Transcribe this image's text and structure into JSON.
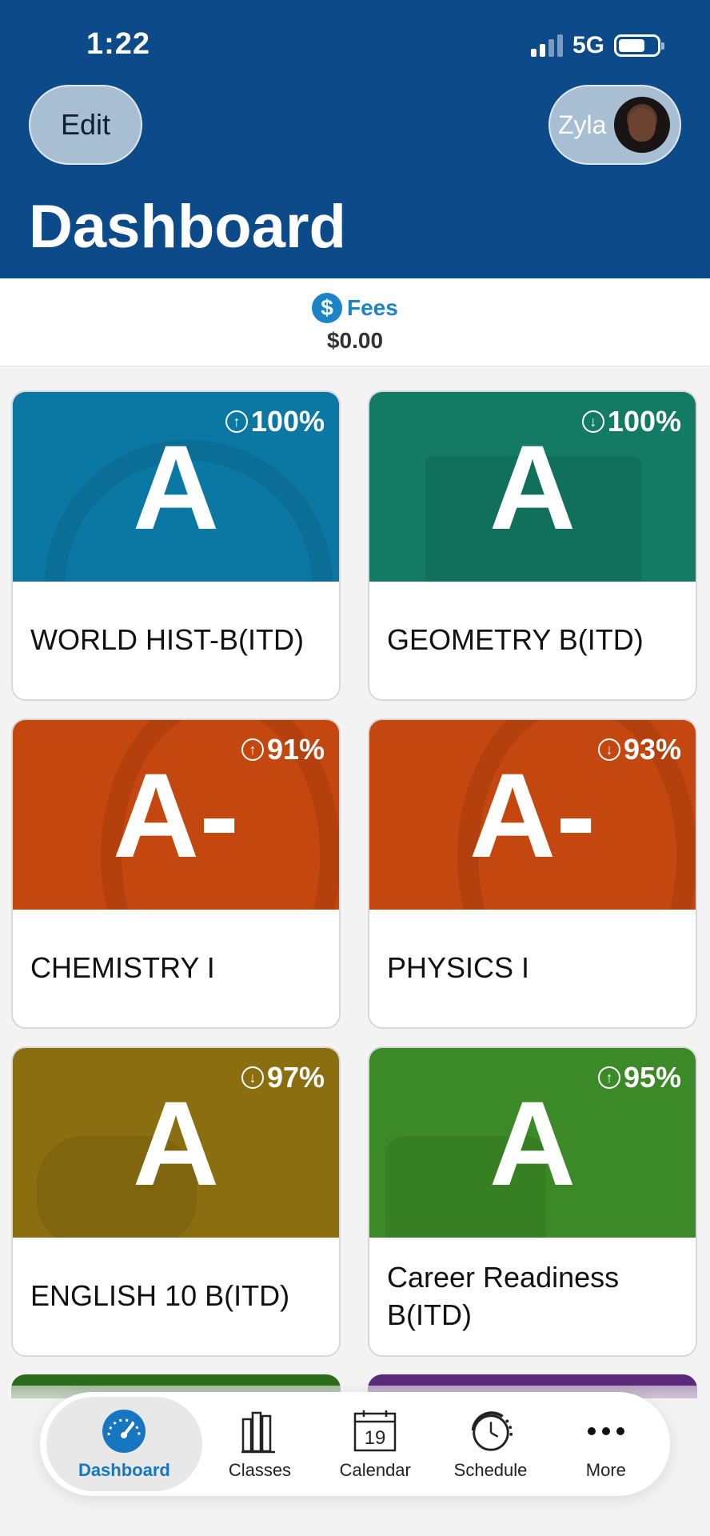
{
  "status": {
    "time": "1:22",
    "network": "5G"
  },
  "header": {
    "edit_label": "Edit",
    "user_name": "Zyla",
    "title": "Dashboard"
  },
  "fees": {
    "label": "Fees",
    "amount": "$0.00"
  },
  "courses": [
    {
      "grade": "A",
      "percent": "100%",
      "trend": "up",
      "name": "WORLD HIST-B(ITD)",
      "color": "#0b78a4"
    },
    {
      "grade": "A",
      "percent": "100%",
      "trend": "down",
      "name": "GEOMETRY B(ITD)",
      "color": "#137a64"
    },
    {
      "grade": "A-",
      "percent": "91%",
      "trend": "up",
      "name": "CHEMISTRY I",
      "color": "#c4470f"
    },
    {
      "grade": "A-",
      "percent": "93%",
      "trend": "down",
      "name": "PHYSICS I",
      "color": "#c4470f"
    },
    {
      "grade": "A",
      "percent": "97%",
      "trend": "down",
      "name": "ENGLISH 10 B(ITD)",
      "color": "#8a6e0f"
    },
    {
      "grade": "A",
      "percent": "95%",
      "trend": "up",
      "name": "Career Readiness B(ITD)",
      "color": "#3c8a27"
    }
  ],
  "tabs": [
    {
      "label": "Dashboard",
      "icon": "speedometer-icon",
      "active": true
    },
    {
      "label": "Classes",
      "icon": "books-icon",
      "active": false
    },
    {
      "label": "Calendar",
      "icon": "calendar-icon",
      "active": false,
      "calendar_day": "19"
    },
    {
      "label": "Schedule",
      "icon": "clock-icon",
      "active": false
    },
    {
      "label": "More",
      "icon": "more-icon",
      "active": false
    }
  ],
  "arrows": {
    "up": "↑",
    "down": "↓"
  }
}
